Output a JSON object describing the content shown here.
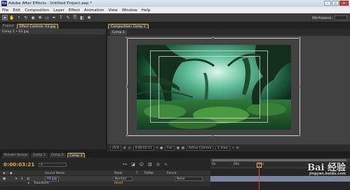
{
  "window": {
    "title": "Adobe After Effects - Untitled Project.aep *",
    "logo": "Ae",
    "controls": [
      "–",
      "▫",
      "✕"
    ]
  },
  "menu": [
    "File",
    "Edit",
    "Composition",
    "Layer",
    "Effect",
    "Animation",
    "View",
    "Window",
    "Help"
  ],
  "toolbar": {
    "tools": [
      "select-tool",
      "hand-tool",
      "zoom-tool",
      "rotate-tool",
      "camera-tool",
      "pan-behind-tool",
      "mask-tool",
      "pen-tool",
      "type-tool",
      "brush-tool",
      "clone-tool",
      "eraser-tool",
      "puppet-tool"
    ],
    "workspace_label": "Workspace:"
  },
  "left_panel": {
    "tabs": [
      "Project",
      "Effect Controls: 03.jpg"
    ],
    "header": "Comp 1 • 03.jpg"
  },
  "comp_panel": {
    "tab": "Composition: Comp 1",
    "comp_tab": "Comp 1"
  },
  "viewer_bar": {
    "zoom": "25%",
    "timecode": "0:00:03:21",
    "resolution": "Full",
    "camera": "Active Camera",
    "views": "1 View"
  },
  "timeline": {
    "tabs": [
      "Render Queue",
      "Comp 1",
      "Comp 2",
      "Comp 3"
    ],
    "active_tab_index": 3,
    "current_time": "0:00:03:21",
    "ruler_marks": [
      "0s",
      "02s",
      "04s"
    ],
    "columns": {
      "source_name": "Source Name",
      "mode": "Mode",
      "t": "T",
      "trkmat": "TrkMat",
      "parent": "Parent"
    },
    "layer": {
      "number": "1",
      "name": "03.jpg",
      "mode": "Normal",
      "parent": "None"
    },
    "transform_label": "Transform",
    "reset_label": "Reset"
  },
  "watermark": {
    "main": "Bai 经验",
    "sub": "jingyan.baidu.com"
  },
  "colors": {
    "timecode": "#e9b23a",
    "cti": "#e04040",
    "layer_bar": "#7d84a0",
    "active_tab_outline": "#e3b130"
  }
}
